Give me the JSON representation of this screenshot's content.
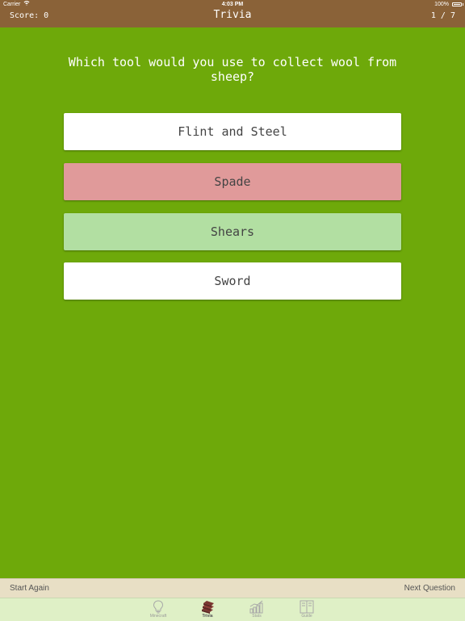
{
  "status_bar": {
    "carrier": "Carrier",
    "time": "4:03 PM",
    "battery": "100%"
  },
  "nav": {
    "score": "Score: 0",
    "title": "Trivia",
    "progress": "1 / 7"
  },
  "question": "Which tool would you use to collect wool from sheep?",
  "answers": [
    {
      "label": "Flint and Steel",
      "state": "default",
      "color": "#ffffff"
    },
    {
      "label": "Spade",
      "state": "incorrect",
      "color": "#e09a9a"
    },
    {
      "label": "Shears",
      "state": "correct",
      "color": "#b2dfa2"
    },
    {
      "label": "Sword",
      "state": "default",
      "color": "#ffffff"
    }
  ],
  "actions": {
    "start_again": "Start Again",
    "next_question": "Next Question"
  },
  "tabs": [
    {
      "label": "Minecraft",
      "icon": "lightbulb-icon",
      "active": false
    },
    {
      "label": "Trivia",
      "icon": "books-icon",
      "active": true
    },
    {
      "label": "Stats",
      "icon": "bar-chart-icon",
      "active": false
    },
    {
      "label": "Guide",
      "icon": "open-book-icon",
      "active": false
    }
  ],
  "colors": {
    "background": "#6ea90a",
    "topbar": "#8a6238",
    "footer": "#e8dfc5",
    "tabbar": "#dff0c6",
    "active_tab_icon": "#7a3530"
  }
}
